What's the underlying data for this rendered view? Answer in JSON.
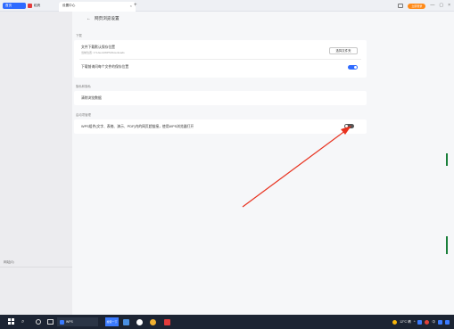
{
  "tabs": {
    "home": "首页",
    "pdf": "稻壳",
    "active": "设置中心",
    "add": "+"
  },
  "window": {
    "login_label": "立即登录",
    "minimize": "—",
    "restore": "▢",
    "close": "×"
  },
  "header": {
    "back": "←",
    "title": "网页浏览设置"
  },
  "sections": {
    "download": {
      "title": "下载",
      "default_location_label": "文件下载默认保存位置",
      "default_location_path": "当前位置: C:\\Users\\WPS\\Downloads",
      "choose_folder": "选择文件夹",
      "ask_each_time_label": "下载前询问每个文件的保存位置",
      "ask_each_time_on": true
    },
    "privacy": {
      "title": "隐私和隐私",
      "clear_data": "清除浏览数据"
    },
    "default_browser": {
      "title": "启动项管理",
      "wps_open_label": "WPS组件(文字、表格、演示、PDF)内的网页超链接，使用WPS浏览器打开",
      "wps_open_on": false
    }
  },
  "sidebar": {
    "footer_label": "网站(0)"
  },
  "taskbar": {
    "app1": "WPS",
    "app2": "搜索一下",
    "weather": "12°C 晴",
    "ime": "中",
    "tray_extra": "^"
  },
  "colors": {
    "accent": "#2f6bff",
    "annotation": "#e8321f",
    "login": "#ff8a18"
  }
}
